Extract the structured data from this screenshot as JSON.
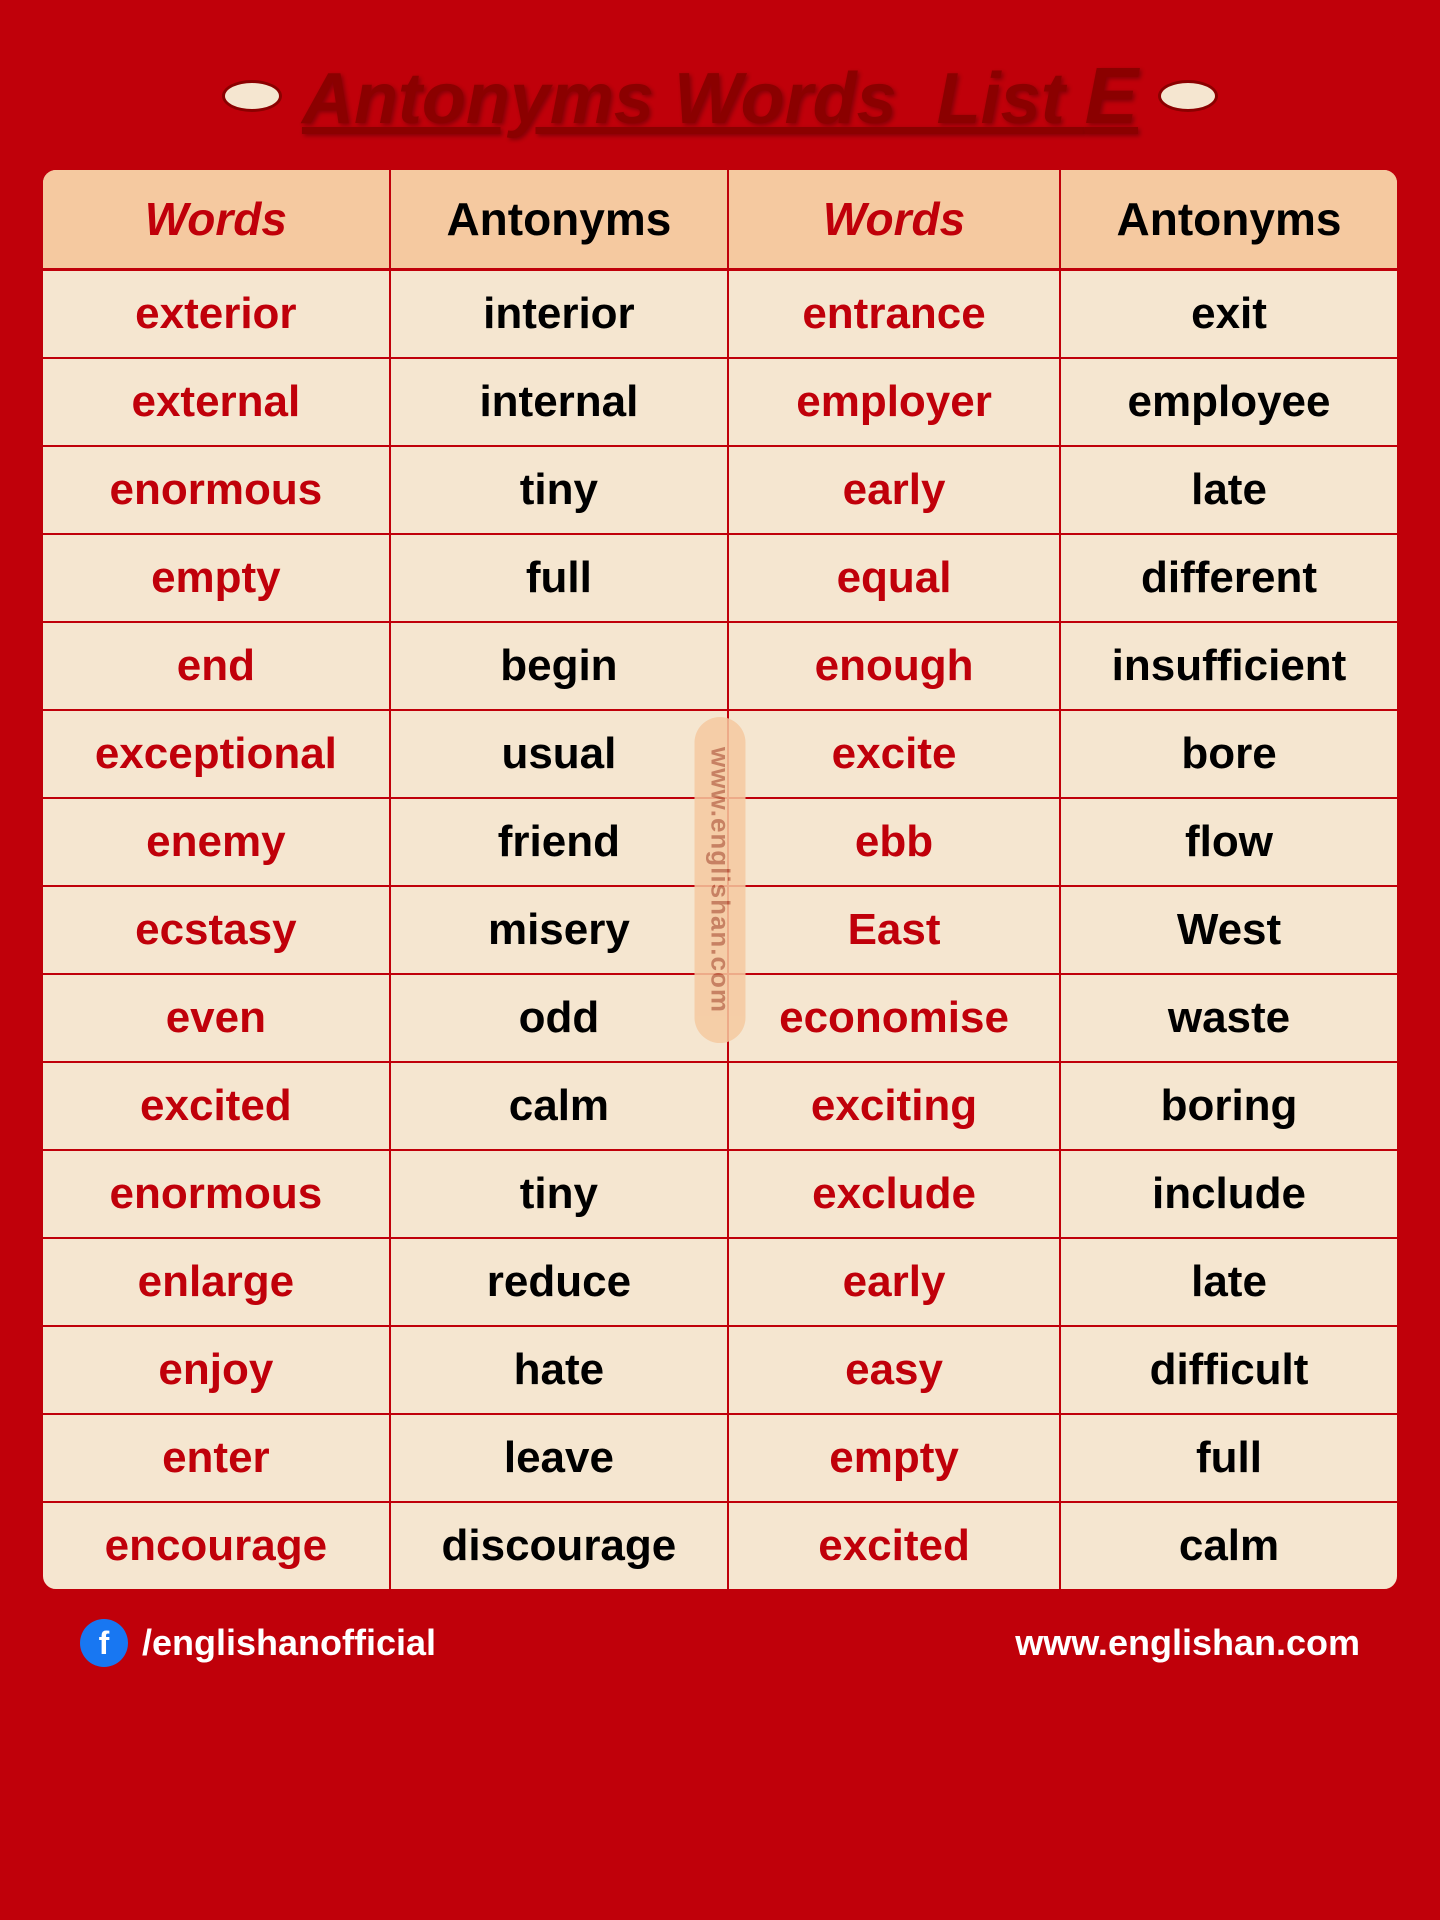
{
  "title": {
    "text": "Antonyms Words  List E",
    "display": "Antonyms Words  List "
  },
  "header": {
    "col1": "Words",
    "col2": "Antonyms",
    "col3": "Words",
    "col4": "Antonyms"
  },
  "rows": [
    {
      "word1": "exterior",
      "ant1": "interior",
      "word2": "entrance",
      "ant2": "exit"
    },
    {
      "word1": "external",
      "ant1": "internal",
      "word2": "employer",
      "ant2": "employee"
    },
    {
      "word1": "enormous",
      "ant1": "tiny",
      "word2": "early",
      "ant2": "late"
    },
    {
      "word1": "empty",
      "ant1": "full",
      "word2": "equal",
      "ant2": "different"
    },
    {
      "word1": "end",
      "ant1": "begin",
      "word2": "enough",
      "ant2": "insufficient"
    },
    {
      "word1": "exceptional",
      "ant1": "usual",
      "word2": "excite",
      "ant2": "bore"
    },
    {
      "word1": "enemy",
      "ant1": "friend",
      "word2": "ebb",
      "ant2": "flow"
    },
    {
      "word1": "ecstasy",
      "ant1": "misery",
      "word2": "East",
      "ant2": "West"
    },
    {
      "word1": "even",
      "ant1": "odd",
      "word2": "economise",
      "ant2": "waste"
    },
    {
      "word1": "excited",
      "ant1": "calm",
      "word2": "exciting",
      "ant2": "boring"
    },
    {
      "word1": "enormous",
      "ant1": "tiny",
      "word2": "exclude",
      "ant2": "include"
    },
    {
      "word1": "enlarge",
      "ant1": "reduce",
      "word2": "early",
      "ant2": "late"
    },
    {
      "word1": "enjoy",
      "ant1": "hate",
      "word2": "easy",
      "ant2": "difficult"
    },
    {
      "word1": "enter",
      "ant1": "leave",
      "word2": "empty",
      "ant2": "full"
    },
    {
      "word1": "encourage",
      "ant1": "discourage",
      "word2": "excited",
      "ant2": "calm"
    }
  ],
  "watermark": "www.englishan.com",
  "footer": {
    "social": "/englishanofficial",
    "website": "www.englishan.com"
  }
}
